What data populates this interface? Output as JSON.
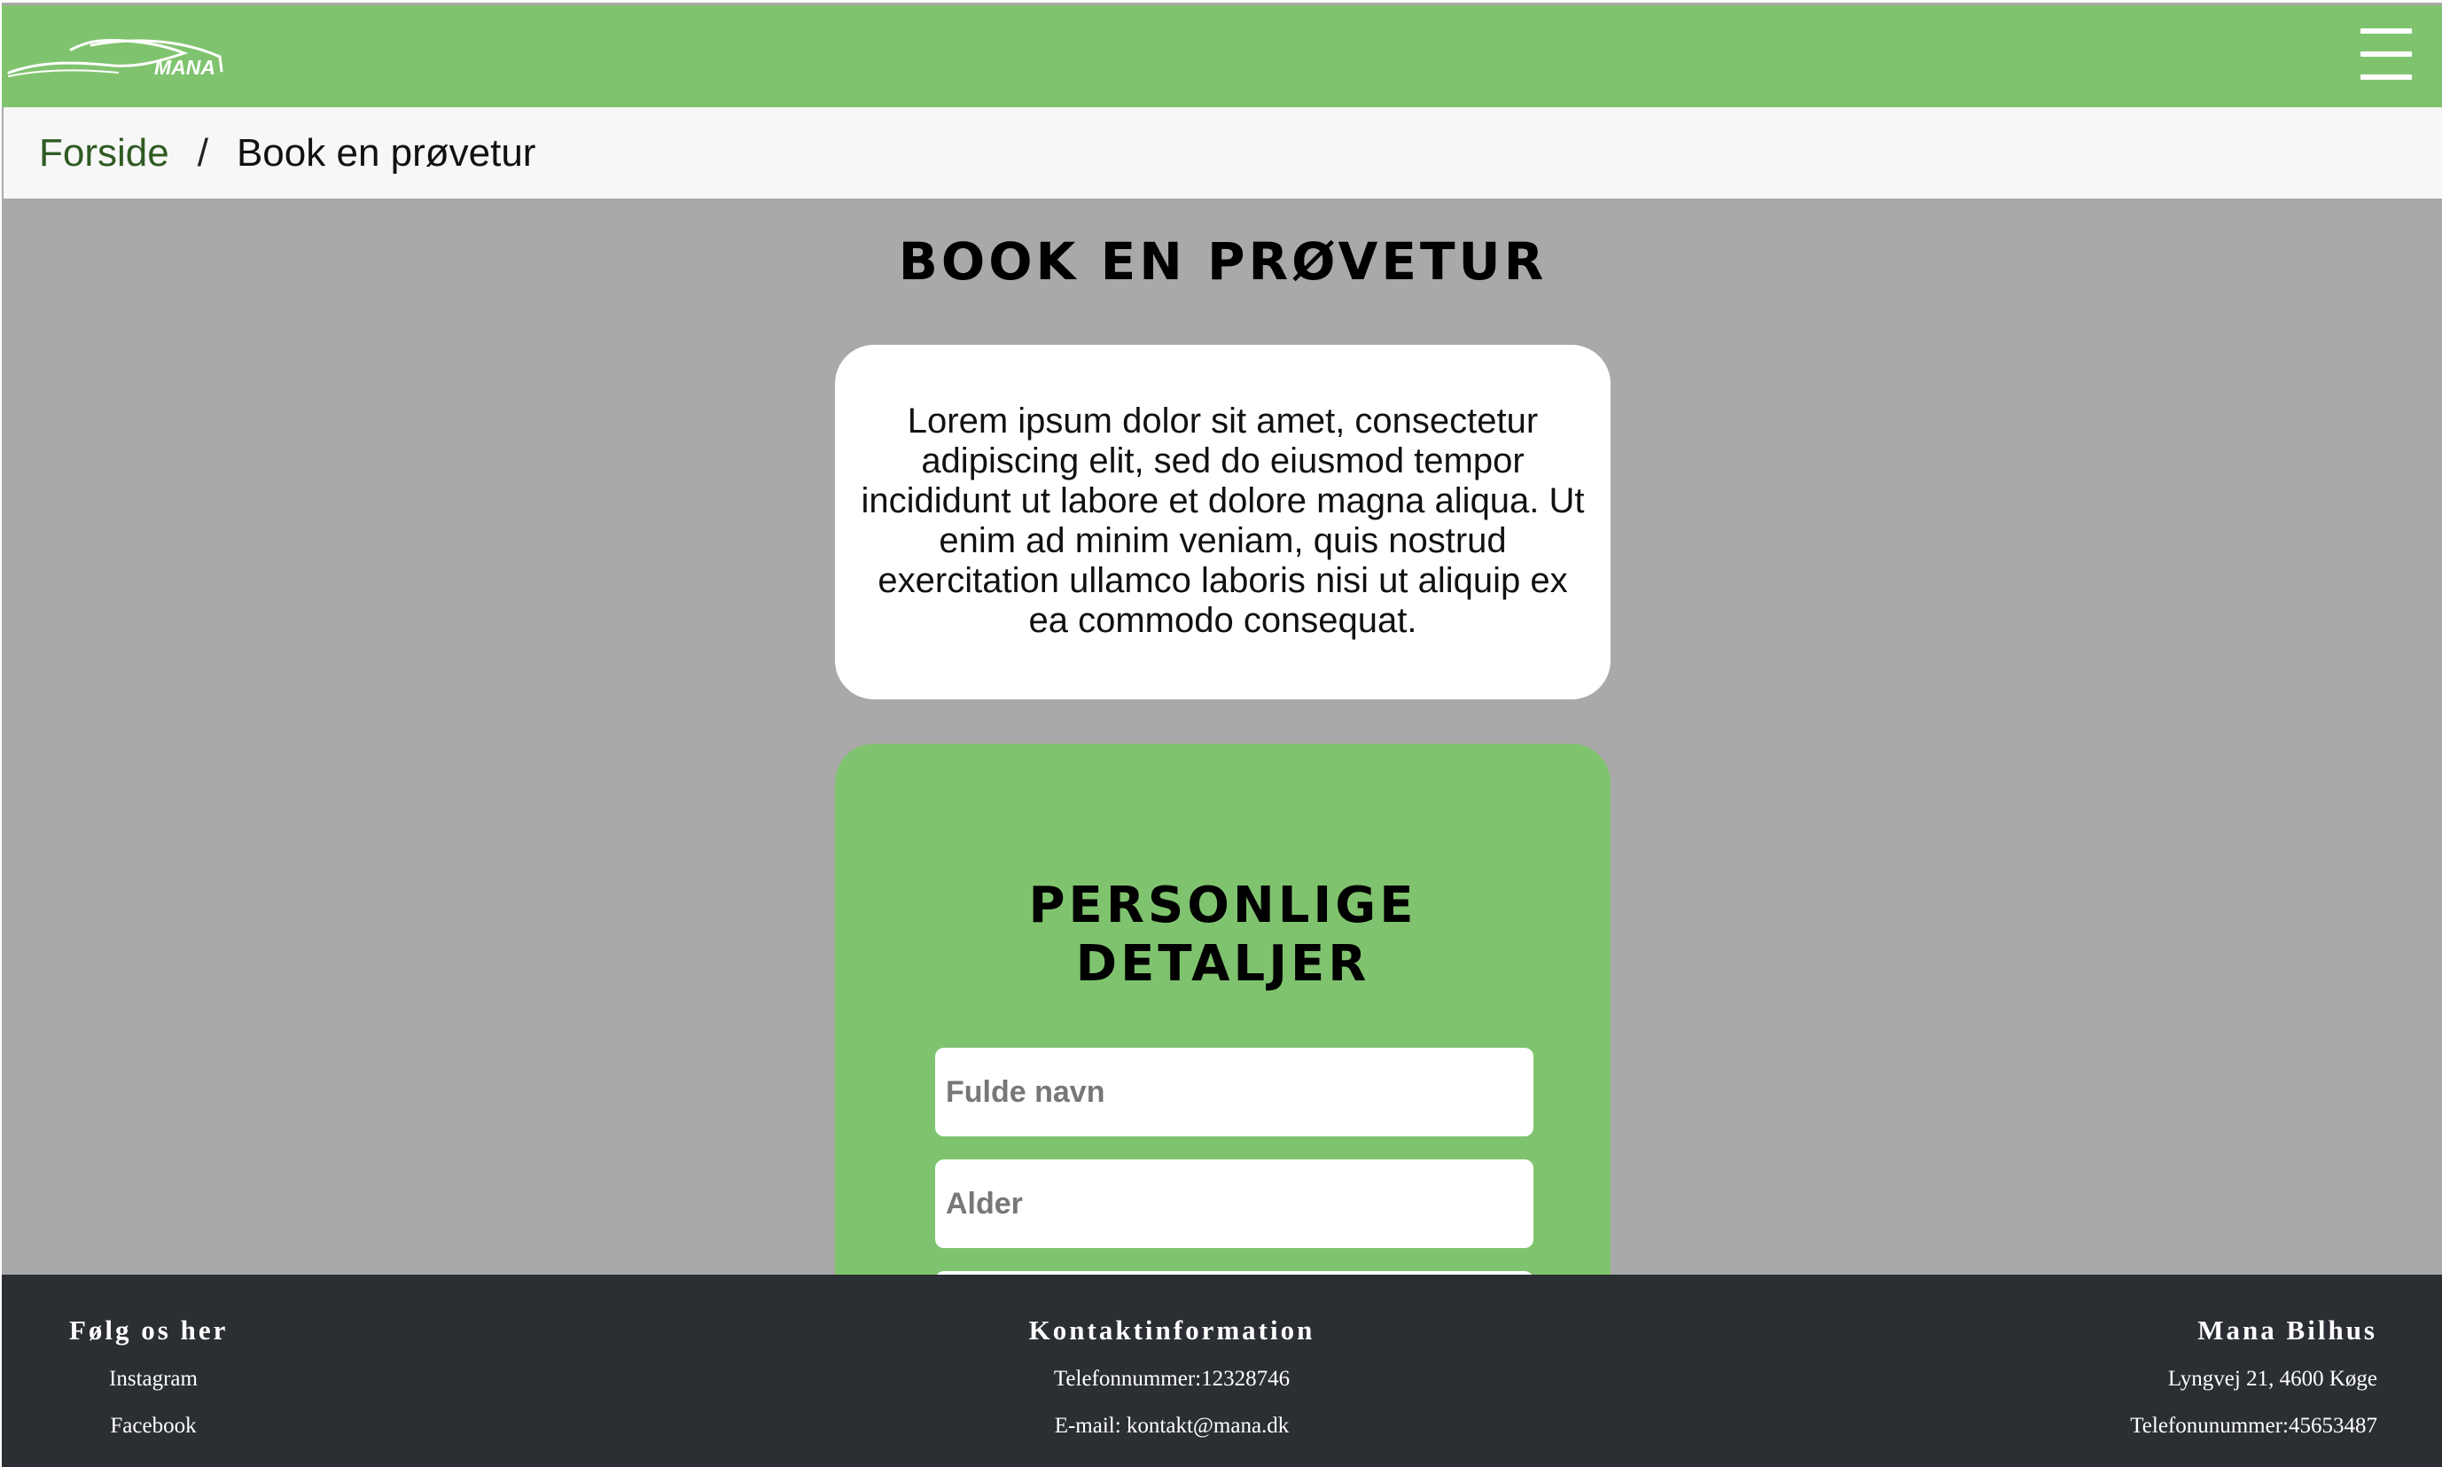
{
  "header": {
    "logo_text": "MANA",
    "colors": {
      "bar": "#80c36f",
      "icon": "#ffffff"
    },
    "menu_icon": "hamburger-menu-icon"
  },
  "breadcrumb": {
    "home": "Forside",
    "separator": "/",
    "current": "Book en prøvetur"
  },
  "main": {
    "title": "BOOK EN PRØVETUR",
    "intro": "Lorem ipsum dolor sit amet, consectetur adipiscing elit, sed do eiusmod tempor incididunt ut labore et dolore magna aliqua. Ut enim ad minim veniam, quis nostrud exercitation ullamco laboris nisi ut aliquip ex ea commodo consequat.",
    "form": {
      "title_line1": "PERSONLIGE",
      "title_line2": "DETALJER",
      "fields": [
        {
          "placeholder": "Fulde navn",
          "value": ""
        },
        {
          "placeholder": "Alder",
          "value": ""
        },
        {
          "placeholder": "",
          "value": ""
        }
      ]
    },
    "colors": {
      "page_bg": "#a9a9a9",
      "card": "#ffffff",
      "form_card": "#80c36f"
    }
  },
  "footer": {
    "follow": {
      "heading": "Følg os her",
      "links": [
        "Instagram",
        "Facebook"
      ]
    },
    "contact": {
      "heading": "Kontaktinformation",
      "phone": "Telefonnummer:12328746",
      "email": "E-mail: kontakt@mana.dk"
    },
    "company": {
      "heading": "Mana Bilhus",
      "address": "Lyngvej 21, 4600 Køge",
      "phone": "Telefonunummer:45653487"
    },
    "colors": {
      "bg": "#2b2e33",
      "text": "#ffffff"
    }
  }
}
